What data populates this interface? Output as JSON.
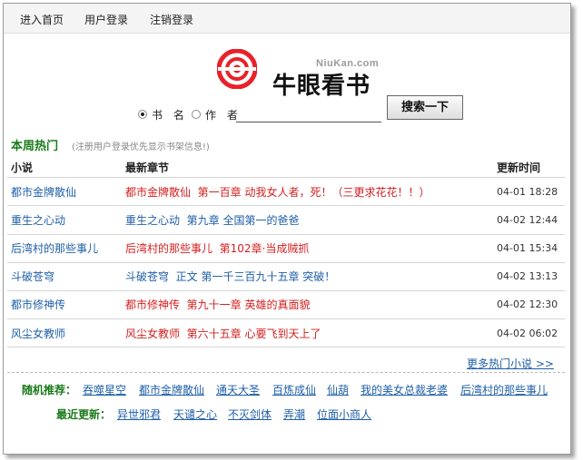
{
  "nav": {
    "home": "进入首页",
    "login": "用户登录",
    "logout": "注销登录"
  },
  "logo": {
    "english": "NiuKan.com",
    "chinese": "牛眼看书",
    "brand_color": "#e8222a"
  },
  "search": {
    "option_title": "书 名",
    "option_author": "作 者",
    "selected": "书名",
    "input_value": "",
    "button": "搜索一下"
  },
  "hot": {
    "title": "本周热门",
    "note": "(注册用户登录优先显示书架信息!)",
    "columns": [
      "小说",
      "最新章节",
      "更新时间"
    ],
    "rows": [
      {
        "novel": "都市金牌散仙",
        "chapter_book": "都市金牌散仙",
        "chapter": "第一百章 动我女人者，死！（三更求花花！！）",
        "time": "04-01 18:28",
        "red": true
      },
      {
        "novel": "重生之心动",
        "chapter_book": "重生之心动",
        "chapter": "第九章 全国第一的爸爸",
        "time": "04-02 12:44",
        "red": false
      },
      {
        "novel": "后湾村的那些事儿",
        "chapter_book": "后湾村的那些事儿",
        "chapter": "第102章·当成贼抓",
        "time": "04-01 15:34",
        "red": true
      },
      {
        "novel": "斗破苍穹",
        "chapter_book": "斗破苍穹",
        "chapter": "正文 第一千三百九十五章 突破！",
        "time": "04-02 13:13",
        "red": false
      },
      {
        "novel": "都市修神传",
        "chapter_book": "都市修神传",
        "chapter": "第九十一章 英雄的真面貌",
        "time": "04-02 12:30",
        "red": true
      },
      {
        "novel": "风尘女教师",
        "chapter_book": "风尘女教师",
        "chapter": "第六十五章 心要飞到天上了",
        "time": "04-02 06:02",
        "red": true
      }
    ],
    "more": "更多热门小说 >>"
  },
  "random": {
    "label": "随机推荐：",
    "items": [
      "吞噬星空",
      "都市金牌散仙",
      "通天大圣",
      "百炼成仙",
      "仙葫",
      "我的美女总裁老婆",
      "后湾村的那些事儿"
    ]
  },
  "recent": {
    "label": "最近更新：",
    "items": [
      "异世邪君",
      "天谴之心",
      "不灭剑体",
      "弄潮",
      "位面小商人"
    ]
  }
}
